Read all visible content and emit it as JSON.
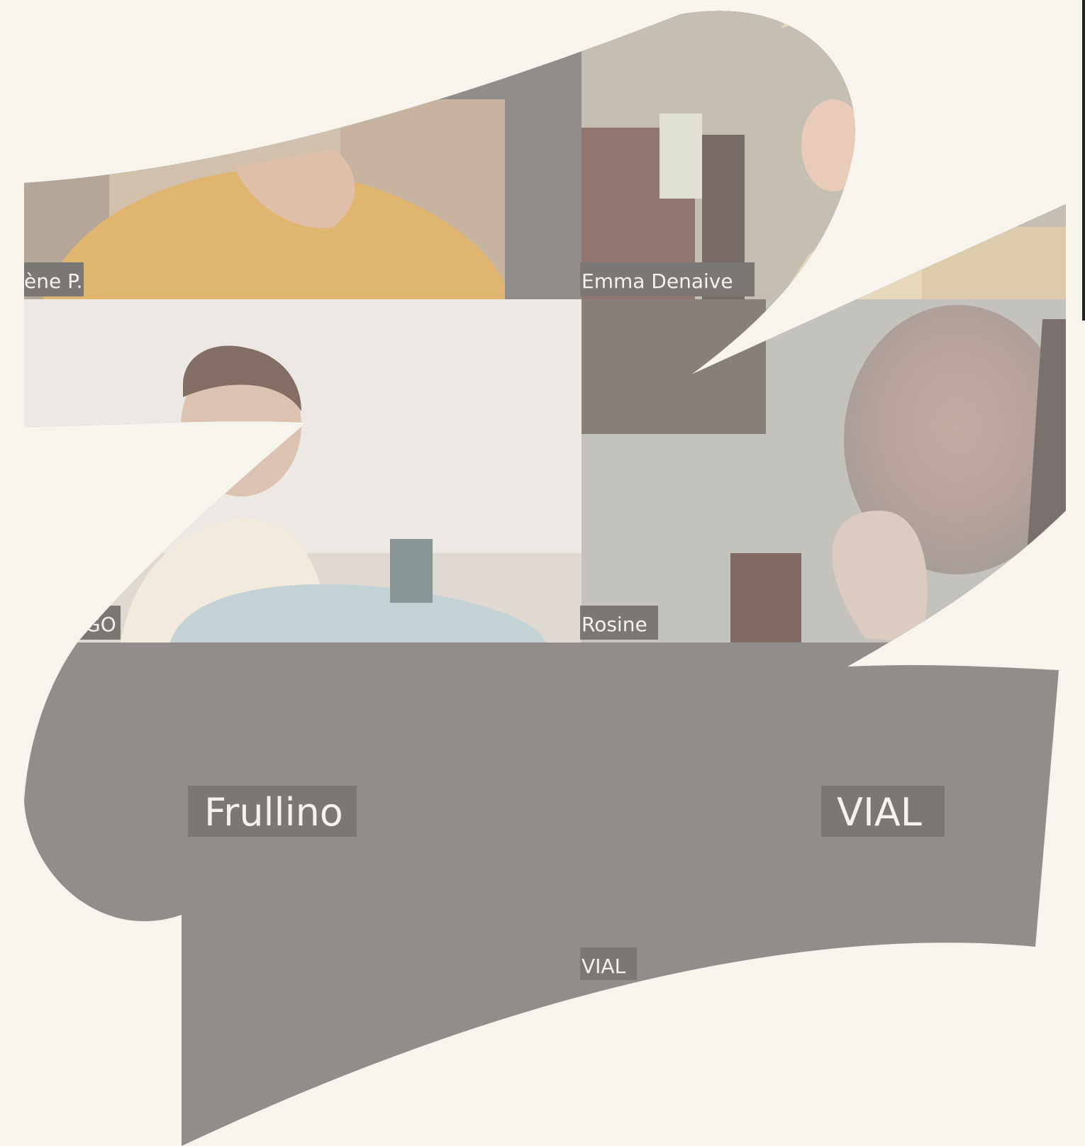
{
  "meeting": {
    "tiles": [
      {
        "id": "tile-1",
        "name": "ène P."
      },
      {
        "id": "tile-2",
        "name": "Emma Denaive"
      },
      {
        "id": "tile-3",
        "name": "GO"
      },
      {
        "id": "tile-4",
        "name": "Rosine"
      }
    ],
    "placeholders": [
      {
        "id": "ph-1",
        "name": "Frullino"
      },
      {
        "id": "ph-2",
        "name": "VIAL"
      },
      {
        "id": "ph-3",
        "name": "VIAL"
      }
    ]
  },
  "colors": {
    "page_bg": "#f7f3ed",
    "empty_tile": "#7a7775",
    "tag_bg": "#5f5c5a",
    "tag_text": "#f4f1ec"
  }
}
